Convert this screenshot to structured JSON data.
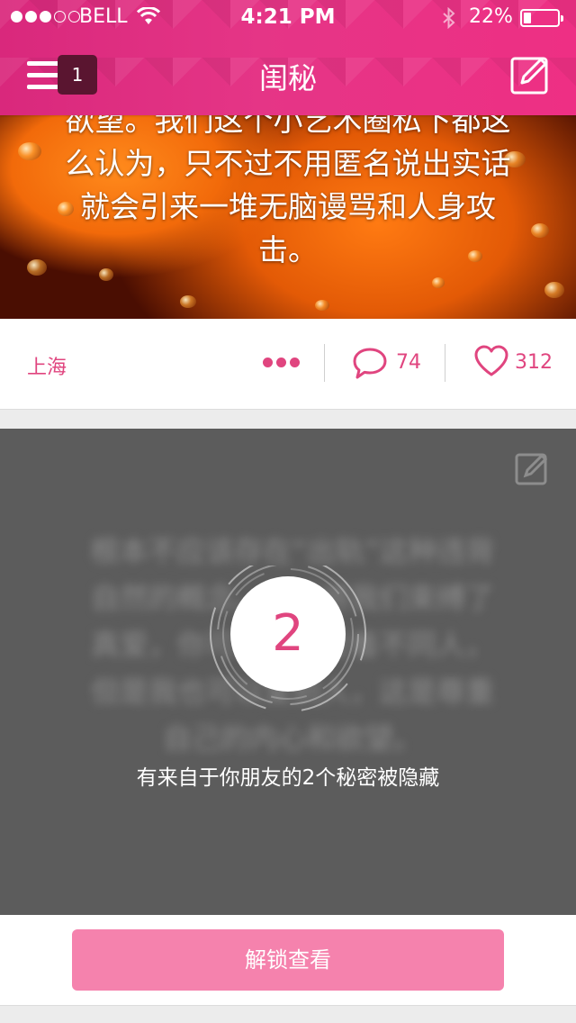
{
  "status_bar": {
    "carrier": "BELL",
    "time": "4:21 PM",
    "battery_percent": "22%",
    "battery_level": 0.22,
    "signal_bars_filled": 3,
    "signal_bars_total": 5
  },
  "nav": {
    "title": "闺秘",
    "menu_badge": "1",
    "menu_icon": "hamburger-icon",
    "compose_icon": "compose-icon"
  },
  "post": {
    "text": "欲望。我们这个小艺术圈私下都这么认为，只不过不用匿名说出实话就会引来一堆无脑谩骂和人身攻击。",
    "location": "上海",
    "comment_count": "74",
    "like_count": "312"
  },
  "hidden_post": {
    "blurred_text": "根本不应该存在“出轨”这种违背自然的概念。命运将我们束缚了真爱，你可以真心爱着不同人，但是我也可以爱别人，这是尊重自己的内心和欲望。",
    "hidden_count": "2",
    "message": "有来自于你朋友的2个秘密被隐藏"
  },
  "unlock": {
    "label": "解锁查看"
  },
  "colors": {
    "accent": "#e0457f",
    "header": "#e5317f",
    "unlock_button": "#f582ad",
    "hidden_bg": "#5c5c5c"
  }
}
